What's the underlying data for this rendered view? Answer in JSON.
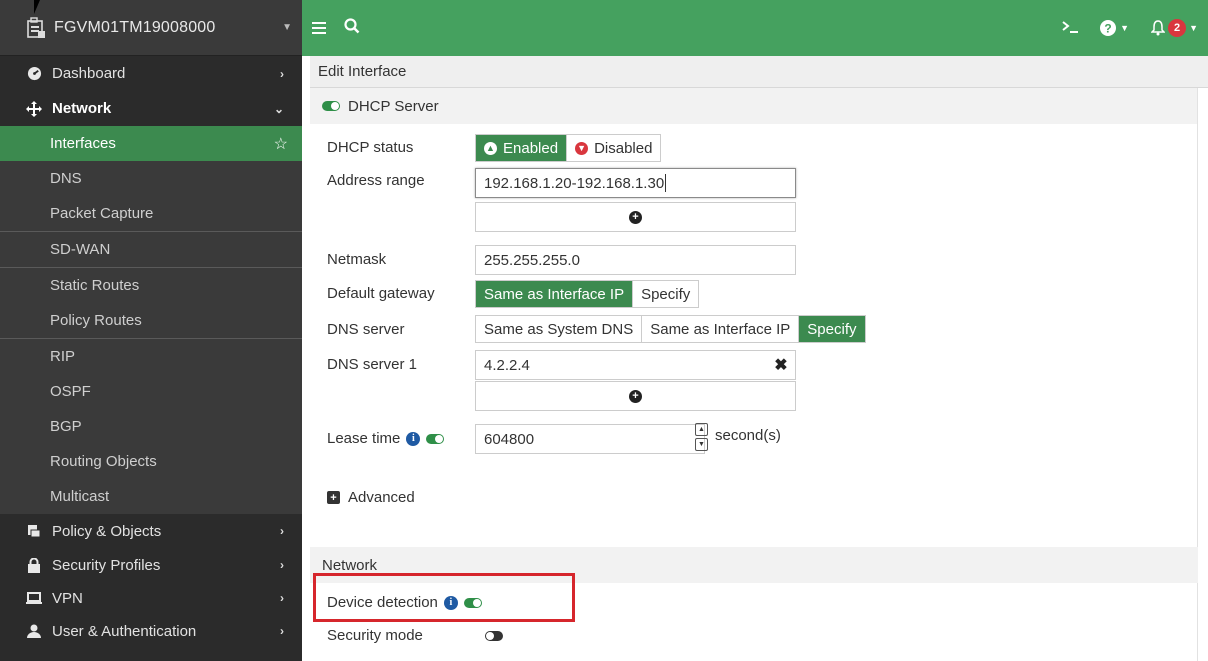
{
  "sidebar": {
    "device_name": "FGVM01TM19008000",
    "items": {
      "dashboard": "Dashboard",
      "network": "Network",
      "policy": "Policy & Objects",
      "security": "Security Profiles",
      "vpn": "VPN",
      "user": "User & Authentication"
    },
    "network_sub": {
      "interfaces": "Interfaces",
      "dns": "DNS",
      "packet_capture": "Packet Capture",
      "sdwan": "SD-WAN",
      "static_routes": "Static Routes",
      "policy_routes": "Policy Routes",
      "rip": "RIP",
      "ospf": "OSPF",
      "bgp": "BGP",
      "routing_objects": "Routing Objects",
      "multicast": "Multicast"
    }
  },
  "topbar": {
    "notification_count": "2"
  },
  "page": {
    "title": "Edit Interface"
  },
  "dhcp": {
    "section_label": "DHCP Server",
    "status_label": "DHCP status",
    "enabled": "Enabled",
    "disabled": "Disabled",
    "address_range_label": "Address range",
    "address_range_value": "192.168.1.20-192.168.1.30",
    "netmask_label": "Netmask",
    "netmask_value": "255.255.255.0",
    "gateway_label": "Default gateway",
    "gateway_same": "Same as Interface IP",
    "gateway_specify": "Specify",
    "dns_label": "DNS server",
    "dns_same_system": "Same as System DNS",
    "dns_same_iface": "Same as Interface IP",
    "dns_specify": "Specify",
    "dns1_label": "DNS server 1",
    "dns1_value": "4.2.2.4",
    "lease_label": "Lease time",
    "lease_value": "604800",
    "lease_unit": "second(s)",
    "advanced_label": "Advanced"
  },
  "network": {
    "section_label": "Network",
    "device_detection_label": "Device detection",
    "security_mode_label": "Security mode"
  },
  "colors": {
    "brand_green": "#45a15f",
    "active_green": "#3c8a4f",
    "highlight_red": "#d6262c"
  }
}
